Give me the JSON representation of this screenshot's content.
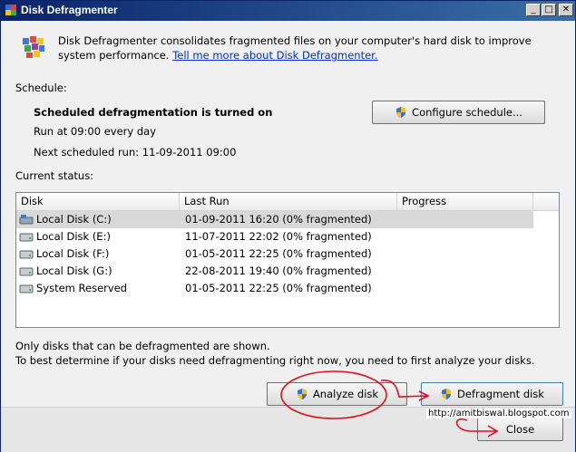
{
  "window": {
    "title": "Disk Defragmenter",
    "controls": {
      "minimize": "_",
      "maximize": "□",
      "close": "✕"
    }
  },
  "intro": {
    "text": "Disk Defragmenter consolidates fragmented files on your computer's hard disk to improve system performance.",
    "link": "Tell me more about Disk Defragmenter."
  },
  "schedule": {
    "section_label": "Schedule:",
    "status": "Scheduled defragmentation is turned on",
    "run_at": "Run at 09:00 every day",
    "next_run": "Next scheduled run: 11-09-2011 09:00",
    "configure_button": "Configure schedule..."
  },
  "current_status": {
    "section_label": "Current status:",
    "columns": [
      "Disk",
      "Last Run",
      "Progress"
    ],
    "rows": [
      {
        "disk": "Local Disk (C:)",
        "last_run": "01-09-2011 16:20 (0% fragmented)",
        "progress": ""
      },
      {
        "disk": "Local Disk (E:)",
        "last_run": "11-07-2011 22:02 (0% fragmented)",
        "progress": ""
      },
      {
        "disk": "Local Disk (F:)",
        "last_run": "01-05-2011 22:25 (0% fragmented)",
        "progress": ""
      },
      {
        "disk": "Local Disk (G:)",
        "last_run": "22-08-2011 19:40 (0% fragmented)",
        "progress": ""
      },
      {
        "disk": "System Reserved",
        "last_run": "01-05-2011 22:25 (0% fragmented)",
        "progress": ""
      }
    ]
  },
  "notes": {
    "line1": "Only disks that can be defragmented are shown.",
    "line2": "To best determine if your disks need defragmenting right now, you need to first analyze your disks."
  },
  "actions": {
    "analyze": "Analyze disk",
    "defragment": "Defragment disk",
    "close": "Close"
  },
  "watermark": "http://amitbiswal.blogspot.com",
  "colors": {
    "annotation": "#e0101a",
    "link": "#0033cc",
    "titlebar": "#0a246a",
    "selection": "#d9d9d9"
  }
}
